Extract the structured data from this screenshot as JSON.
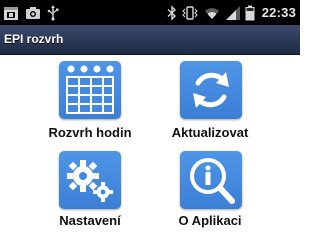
{
  "status_bar": {
    "left_icons": [
      "calendar-icon",
      "camera-icon",
      "usb-icon"
    ],
    "right_icons": [
      "bluetooth-icon",
      "vibrate-icon",
      "wifi-icon",
      "signal-icon",
      "battery-icon"
    ],
    "time": "22:33"
  },
  "app": {
    "title": "EPI rozvrh"
  },
  "tiles": [
    {
      "label": "Rozvrh hodin",
      "icon": "schedule-grid-icon"
    },
    {
      "label": "Aktualizovat",
      "icon": "refresh-icon"
    },
    {
      "label": "Nastavení",
      "icon": "gears-icon"
    },
    {
      "label": "O Aplikaci",
      "icon": "info-magnifier-icon"
    }
  ],
  "colors": {
    "status_bar": "#000000",
    "title_bar": "#2a3957",
    "tile_icon_bg": "#4589df"
  }
}
